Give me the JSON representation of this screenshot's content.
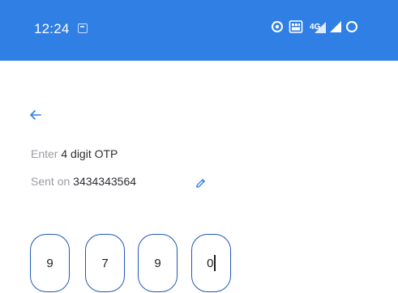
{
  "status_bar": {
    "time": "12:24",
    "left_icons": [
      "calendar-icon"
    ],
    "right_icons": [
      "vpn-icon",
      "data-saver-icon",
      "signal-4g-icon",
      "wifi-icon",
      "battery-icon"
    ],
    "background": "#2f7fe4"
  },
  "otp_screen": {
    "back_icon": "back-arrow-icon",
    "instruction_prefix": "Enter",
    "instruction_strong": "4 digit OTP",
    "sent_prefix": "Sent on",
    "phone_number": "3434343564",
    "edit_icon": "edit-pencil-icon",
    "otp_digits": [
      "9",
      "7",
      "9",
      "0"
    ],
    "focused_box_index": 3,
    "accent_color": "#1f57b4"
  }
}
